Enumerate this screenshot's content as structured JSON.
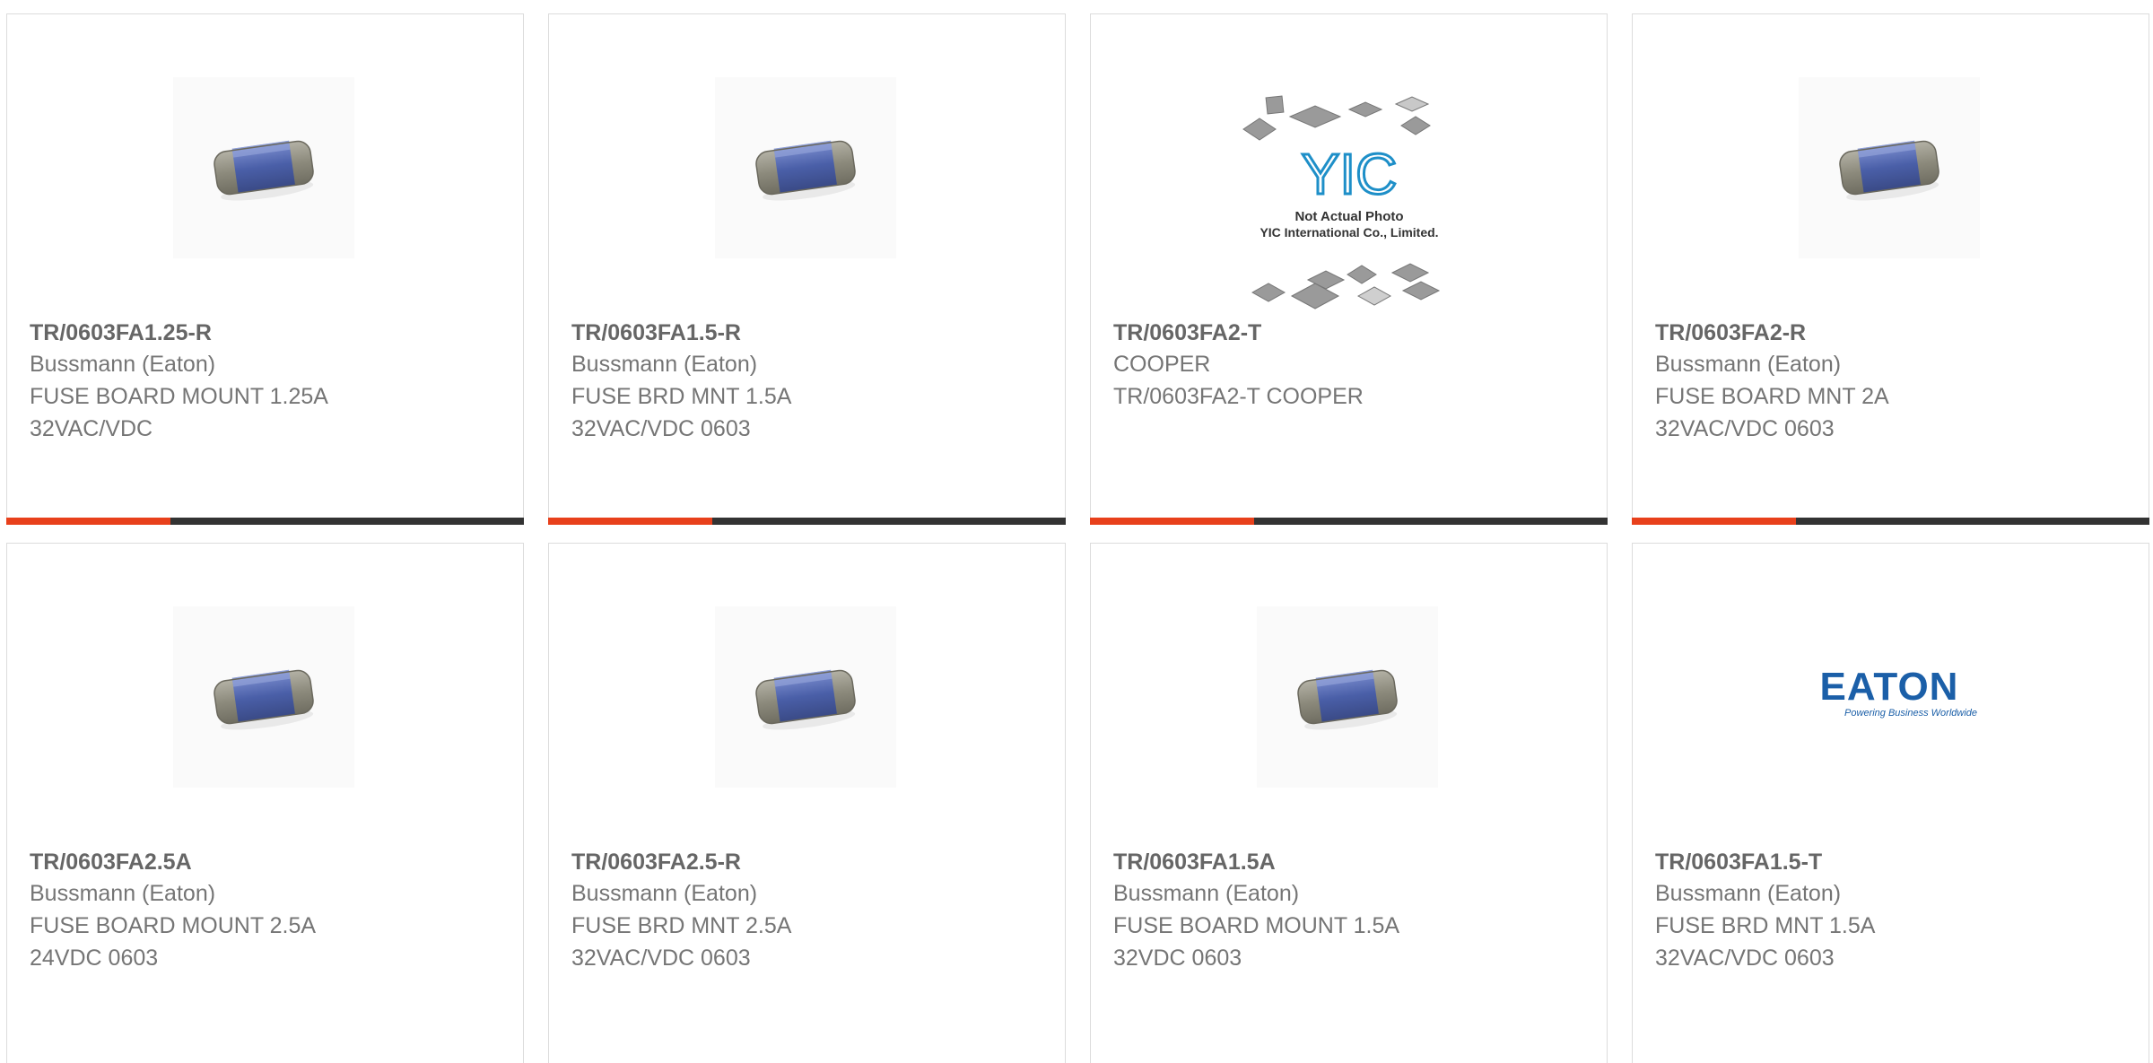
{
  "colors": {
    "accent": "#e8401b",
    "bar_dark": "#333333",
    "text_bold": "#666666",
    "text_regular": "#757575",
    "fuse_blue": "#4a5fa8",
    "fuse_cap": "#8c8a7c",
    "eaton_blue": "#1b5fa8"
  },
  "products": [
    {
      "part_number": "TR/0603FA1.25-R",
      "manufacturer": "Bussmann (Eaton)",
      "description": "FUSE BOARD MOUNT 1.25A\n32VAC/VDC",
      "image_icon": "smd-fuse-icon"
    },
    {
      "part_number": "TR/0603FA1.5-R",
      "manufacturer": "Bussmann (Eaton)",
      "description": "FUSE BRD MNT 1.5A\n32VAC/VDC 0603",
      "image_icon": "smd-fuse-icon"
    },
    {
      "part_number": "TR/0603FA2-T",
      "manufacturer": "COOPER",
      "description": "TR/0603FA2-T COOPER",
      "image_icon": "yic-placeholder-icon",
      "placeholder": {
        "logo": "YIC",
        "line1": "Not Actual Photo",
        "line2": "YIC International Co., Limited."
      }
    },
    {
      "part_number": "TR/0603FA2-R",
      "manufacturer": "Bussmann (Eaton)",
      "description": "FUSE BOARD MNT 2A\n32VAC/VDC 0603",
      "image_icon": "smd-fuse-icon"
    },
    {
      "part_number": "TR/0603FA2.5A",
      "manufacturer": "Bussmann (Eaton)",
      "description": "FUSE BOARD MOUNT 2.5A\n24VDC 0603",
      "image_icon": "smd-fuse-icon"
    },
    {
      "part_number": "TR/0603FA2.5-R",
      "manufacturer": "Bussmann (Eaton)",
      "description": "FUSE BRD MNT 2.5A\n32VAC/VDC 0603",
      "image_icon": "smd-fuse-icon"
    },
    {
      "part_number": "TR/0603FA1.5A",
      "manufacturer": "Bussmann (Eaton)",
      "description": "FUSE BOARD MOUNT 1.5A\n32VDC 0603",
      "image_icon": "smd-fuse-icon"
    },
    {
      "part_number": "TR/0603FA1.5-T",
      "manufacturer": "Bussmann (Eaton)",
      "description": "FUSE BRD MNT 1.5A\n32VAC/VDC 0603",
      "image_icon": "eaton-logo-icon",
      "logo": {
        "brand": "EATON",
        "tagline": "Powering Business Worldwide"
      }
    }
  ]
}
